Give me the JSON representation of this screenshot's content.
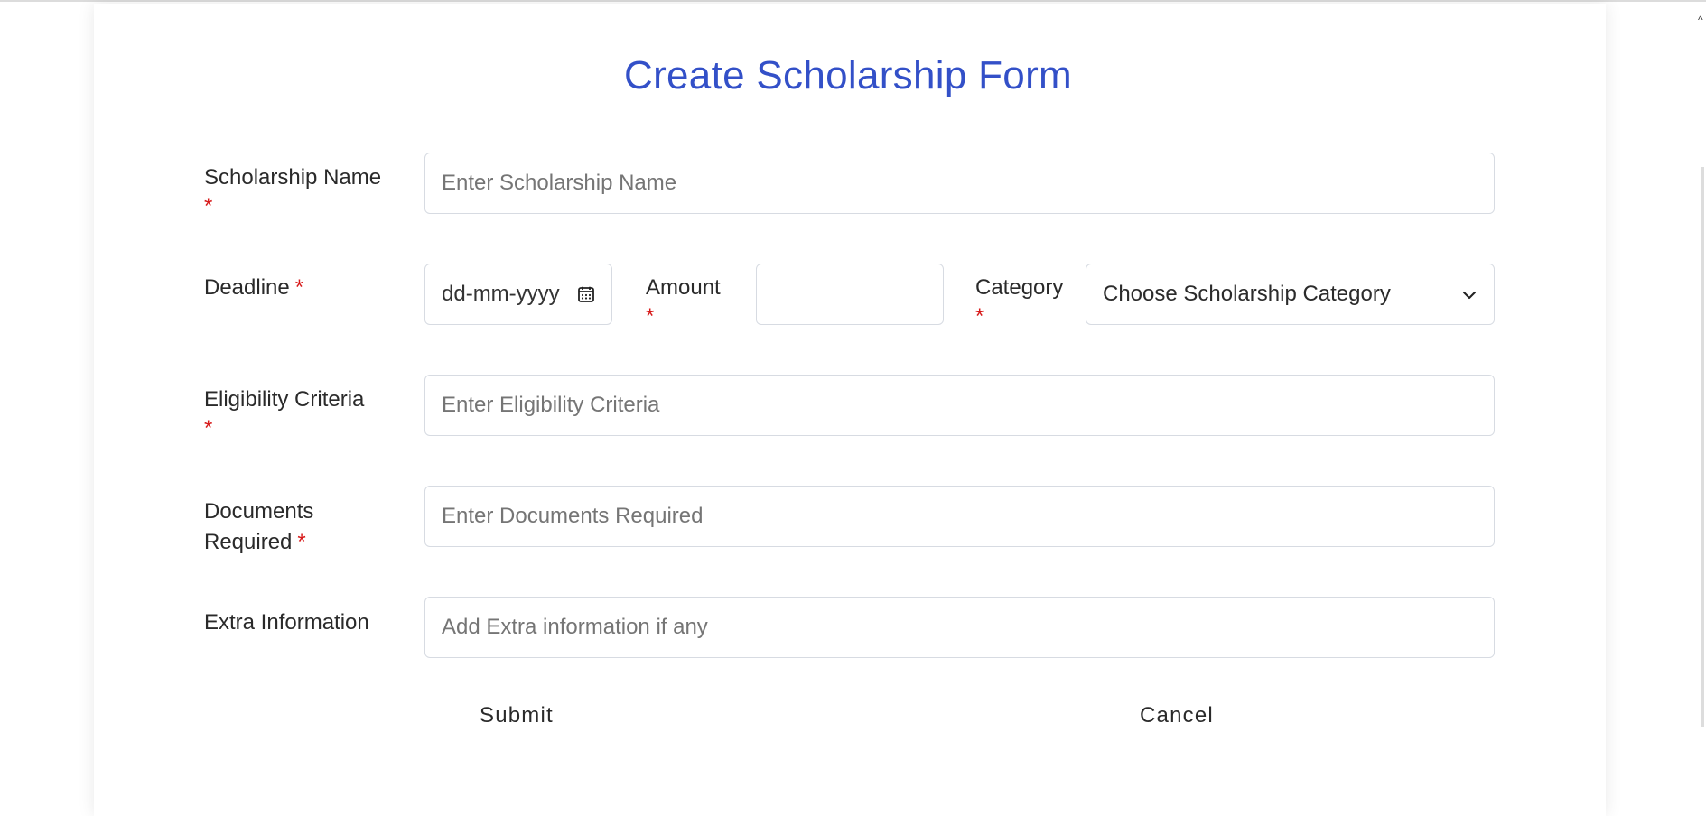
{
  "form": {
    "title": "Create Scholarship Form",
    "required_mark": "*",
    "scholarship_name": {
      "label": "Scholarship Name",
      "placeholder": "Enter Scholarship Name"
    },
    "deadline": {
      "label": "Deadline",
      "placeholder": "dd-mm-yyyy"
    },
    "amount": {
      "label": "Amount",
      "value": ""
    },
    "category": {
      "label": "Category",
      "selected": "Choose Scholarship Category"
    },
    "eligibility": {
      "label": "Eligibility Criteria",
      "placeholder": "Enter Eligibility Criteria"
    },
    "documents": {
      "label_line1": "Documents",
      "label_line2": "Required",
      "placeholder": "Enter Documents Required"
    },
    "extra": {
      "label": "Extra Information",
      "placeholder": "Add Extra information if any"
    },
    "buttons": {
      "submit": "Submit",
      "cancel": "Cancel"
    }
  },
  "icons": {
    "calendar": "calendar-icon",
    "dropdown": "chevron-down-icon"
  },
  "colors": {
    "title": "#3350c8",
    "required": "#d71919",
    "border": "#d7dbe2"
  }
}
